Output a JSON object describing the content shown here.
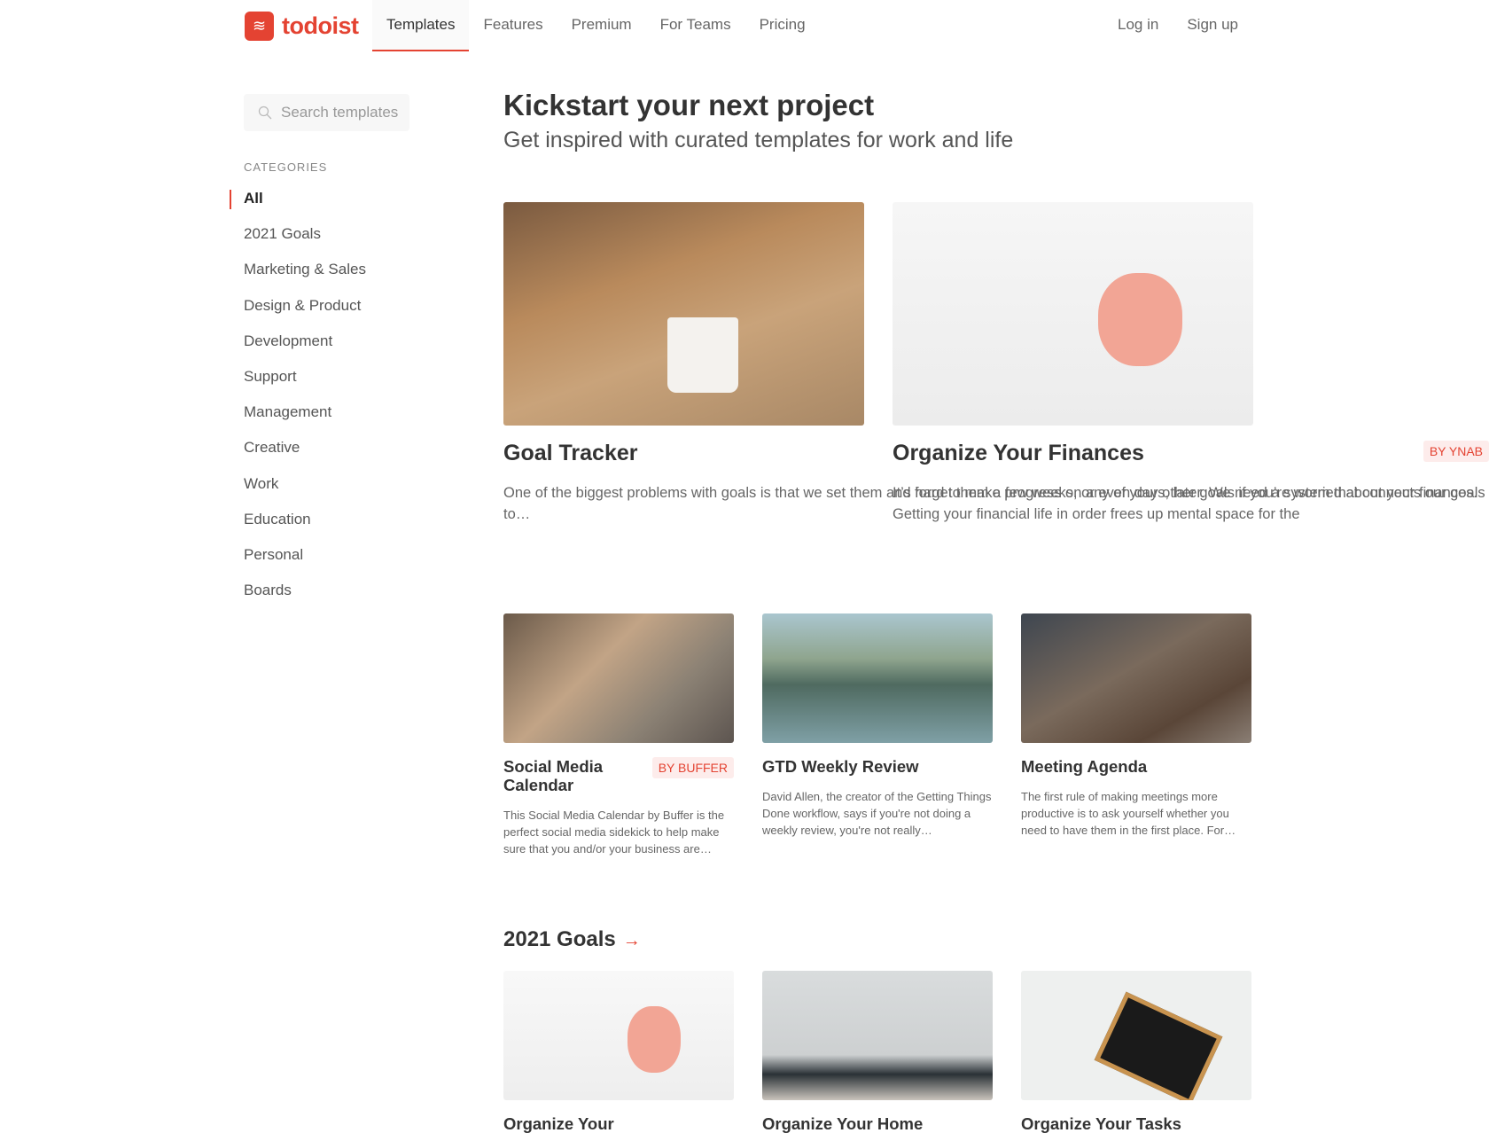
{
  "header": {
    "logo": "todoist",
    "nav": [
      "Templates",
      "Features",
      "Premium",
      "For Teams",
      "Pricing"
    ],
    "active_nav": "Templates",
    "login": "Log in",
    "signup": "Sign up"
  },
  "sidebar": {
    "search_placeholder": "Search templates",
    "categories_heading": "CATEGORIES",
    "categories": [
      "All",
      "2021 Goals",
      "Marketing & Sales",
      "Design & Product",
      "Development",
      "Support",
      "Management",
      "Creative",
      "Work",
      "Education",
      "Personal",
      "Boards"
    ],
    "active": "All"
  },
  "main": {
    "title": "Kickstart your next project",
    "subtitle": "Get inspired with curated templates for work and life",
    "featured": [
      {
        "title": "Goal Tracker",
        "badge": "",
        "description": "One of the biggest problems with goals is that we set them and forget them a few weeks, or even days, later. We need a system that connects our goals to…"
      },
      {
        "title": "Organize Your Finances",
        "badge": "BY YNAB",
        "description": "It’s hard to make progress on any of your other goals if you’re worried about your finances. Getting your financial life in order frees up mental space for the"
      }
    ],
    "cards": [
      {
        "title": "Social Media Calendar",
        "badge": "BY BUFFER",
        "description": "This Social Media Calendar by Buffer is the perfect social media sidekick to help make sure that you and/or your business are…"
      },
      {
        "title": "GTD Weekly Review",
        "badge": "",
        "description": "David Allen, the creator of the Getting Things Done workflow, says if you're not doing a weekly review, you're not really…"
      },
      {
        "title": "Meeting Agenda",
        "badge": "",
        "description": "The first rule of making meetings more productive is to ask yourself whether you need to have them in the first place. For…"
      }
    ],
    "section": {
      "title": "2021 Goals",
      "arrow": "→",
      "cards": [
        {
          "title": "Organize Your"
        },
        {
          "title": "Organize Your Home"
        },
        {
          "title": "Organize Your Tasks"
        }
      ]
    }
  },
  "colors": {
    "accent": "#e44332",
    "badge_bg": "#fdeceb"
  }
}
